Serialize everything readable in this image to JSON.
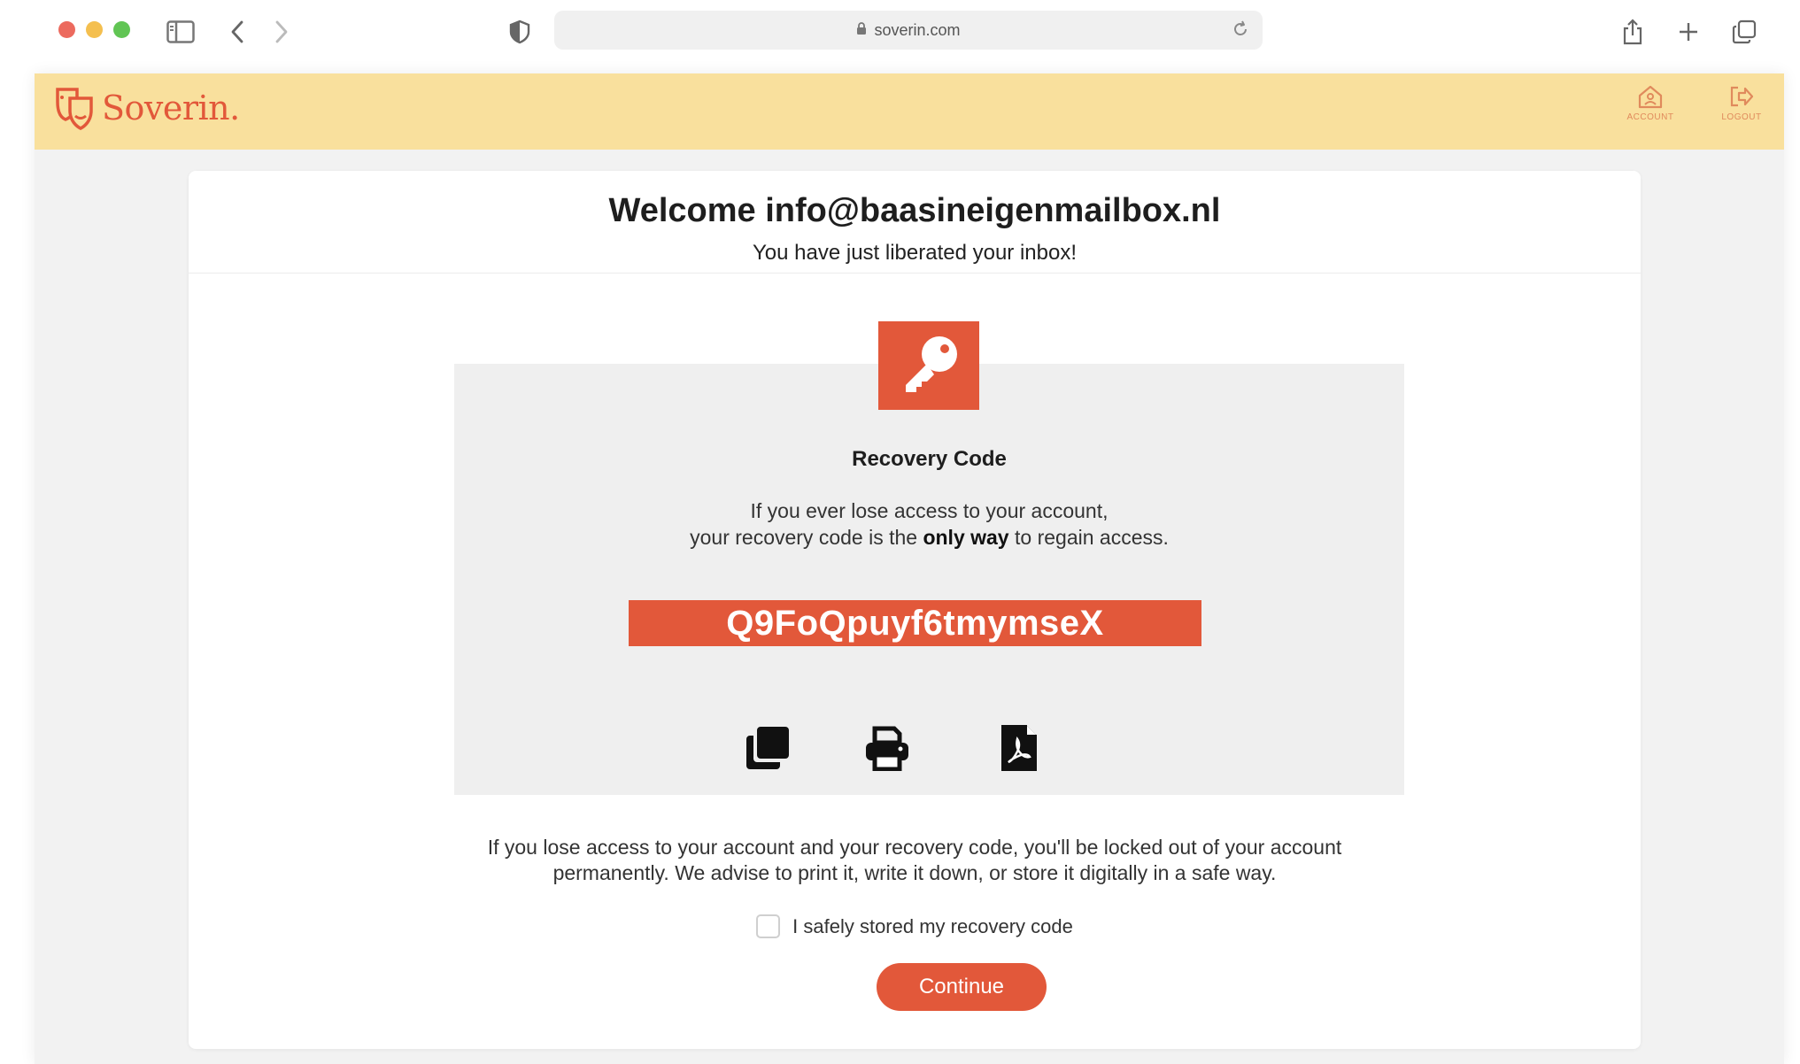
{
  "browser": {
    "url": "soverin.com",
    "traffic_colors": [
      "#ec6a5e",
      "#f4bf4f",
      "#61c554"
    ]
  },
  "topbar": {
    "brand": "Soverin.",
    "account_label": "ACCOUNT",
    "logout_label": "LOGOUT",
    "background": "#f9e09d",
    "accent": "#e2583a"
  },
  "card": {
    "welcome": "Welcome info@baasineigenmailbox.nl",
    "subtitle": "You have just liberated your inbox!",
    "panel_title": "Recovery Code",
    "panel_line1": "If you ever lose access to your account,",
    "panel_line2_pre": "your recovery code is the ",
    "panel_line2_bold": "only way",
    "panel_line2_post": " to regain access.",
    "recovery_code": "Q9FoQpuyf6tmymseX",
    "actions": [
      "copy-icon",
      "print-icon",
      "pdf-icon"
    ],
    "warning_line1": "If you lose access to your account and your recovery code, you'll be locked out of your account",
    "warning_line2": "permanently. We advise to print it, write it down, or store it digitally in a safe way.",
    "checkbox_label": "I safely stored my recovery code",
    "checkbox_checked": false,
    "continue_label": "Continue"
  }
}
